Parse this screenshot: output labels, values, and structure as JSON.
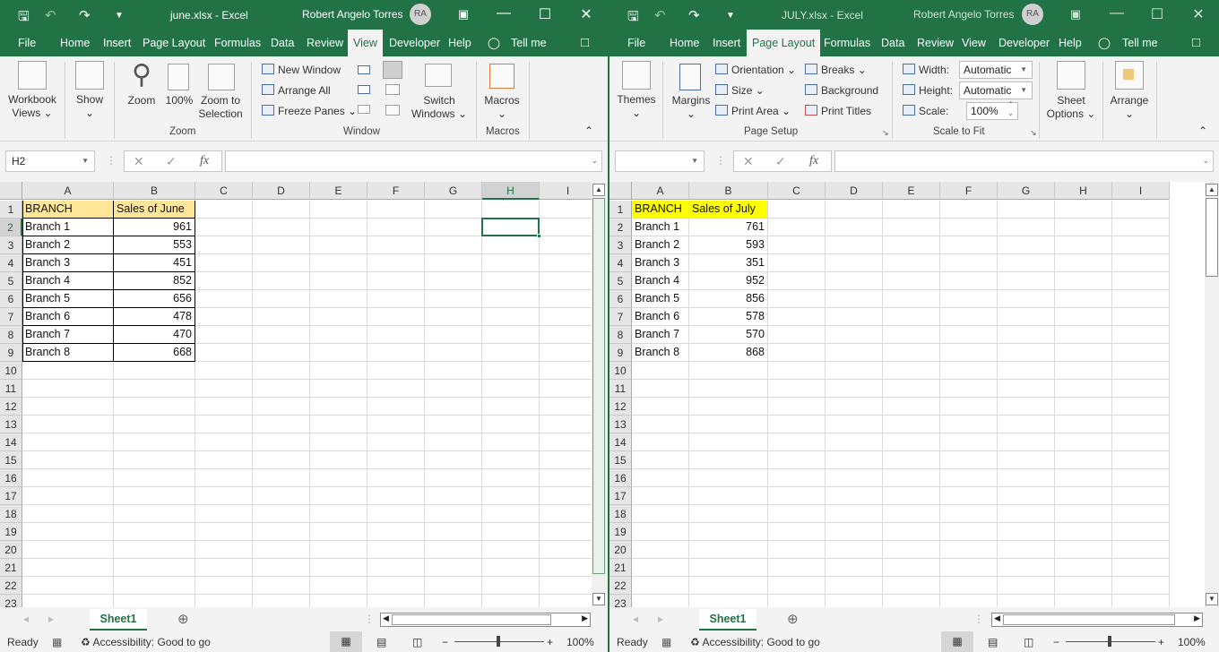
{
  "windows": [
    {
      "id": "june",
      "title": "june.xlsx  -  Excel",
      "user": "Robert Angelo Torres",
      "avatar": "RA",
      "tabs": [
        "File",
        "Home",
        "Insert",
        "Page Layout",
        "Formulas",
        "Data",
        "Review",
        "View",
        "Developer",
        "Help",
        "Tell me"
      ],
      "active_tab": "View",
      "ribbon": {
        "workbook_views": "Workbook Views",
        "show": "Show",
        "zoom": "Zoom",
        "zoom100": "100%",
        "zoom_sel_1": "Zoom to",
        "zoom_sel_2": "Selection",
        "zoom_group": "Zoom",
        "new_window": "New Window",
        "arrange_all": "Arrange All",
        "freeze_panes": "Freeze Panes",
        "switch_1": "Switch",
        "switch_2": "Windows",
        "window_group": "Window",
        "macros": "Macros",
        "macros_group": "Macros"
      },
      "name_box": "H2",
      "formula": "",
      "columns": [
        "A",
        "B",
        "C",
        "D",
        "E",
        "F",
        "G",
        "H",
        "I"
      ],
      "selected_column": "H",
      "selected_cell": "H2",
      "header": [
        "BRANCH",
        "Sales of June"
      ],
      "header_color": "#ffe699",
      "rows": [
        [
          "Branch 1",
          "961"
        ],
        [
          "Branch 2",
          "553"
        ],
        [
          "Branch 3",
          "451"
        ],
        [
          "Branch 4",
          "852"
        ],
        [
          "Branch 5",
          "656"
        ],
        [
          "Branch 6",
          "478"
        ],
        [
          "Branch 7",
          "470"
        ],
        [
          "Branch 8",
          "668"
        ]
      ],
      "row_numbers": [
        "1",
        "2",
        "3",
        "4",
        "5",
        "6",
        "7",
        "8",
        "9",
        "10",
        "11",
        "12",
        "13",
        "14",
        "15",
        "16",
        "17",
        "18",
        "19",
        "20",
        "21",
        "22",
        "23"
      ],
      "sheet_tab": "Sheet1",
      "status": {
        "ready": "Ready",
        "accessibility": "Accessibility: Good to go",
        "zoom": "100%"
      }
    },
    {
      "id": "july",
      "title": "JULY.xlsx  -  Excel",
      "user": "Robert Angelo Torres",
      "avatar": "RA",
      "tabs": [
        "File",
        "Home",
        "Insert",
        "Page Layout",
        "Formulas",
        "Data",
        "Review",
        "View",
        "Developer",
        "Help",
        "Tell me"
      ],
      "active_tab": "Page Layout",
      "ribbon": {
        "themes": "Themes",
        "margins": "Margins",
        "orientation": "Orientation",
        "size": "Size",
        "print_area": "Print Area",
        "breaks": "Breaks",
        "background": "Background",
        "print_titles": "Print Titles",
        "page_setup_group": "Page Setup",
        "width_label": "Width:",
        "width_value": "Automatic",
        "height_label": "Height:",
        "height_value": "Automatic",
        "scale_label": "Scale:",
        "scale_value": "100%",
        "scale_group": "Scale to Fit",
        "sheet_options_1": "Sheet",
        "sheet_options_2": "Options",
        "arrange": "Arrange"
      },
      "name_box": "",
      "formula": "",
      "columns": [
        "A",
        "B",
        "C",
        "D",
        "E",
        "F",
        "G",
        "H",
        "I"
      ],
      "header": [
        "BRANCH",
        "Sales of July"
      ],
      "header_color": "#ffff00",
      "rows": [
        [
          "Branch 1",
          "761"
        ],
        [
          "Branch 2",
          "593"
        ],
        [
          "Branch 3",
          "351"
        ],
        [
          "Branch 4",
          "952"
        ],
        [
          "Branch 5",
          "856"
        ],
        [
          "Branch 6",
          "578"
        ],
        [
          "Branch 7",
          "570"
        ],
        [
          "Branch 8",
          "868"
        ]
      ],
      "row_numbers": [
        "1",
        "2",
        "3",
        "4",
        "5",
        "6",
        "7",
        "8",
        "9",
        "10",
        "11",
        "12",
        "13",
        "14",
        "15",
        "16",
        "17",
        "18",
        "19",
        "20",
        "21",
        "22",
        "23"
      ],
      "sheet_tab": "Sheet1",
      "status": {
        "ready": "Ready",
        "accessibility": "Accessibility: Good to go",
        "zoom": "100%"
      }
    }
  ],
  "colors": {
    "excel_green": "#217346"
  }
}
